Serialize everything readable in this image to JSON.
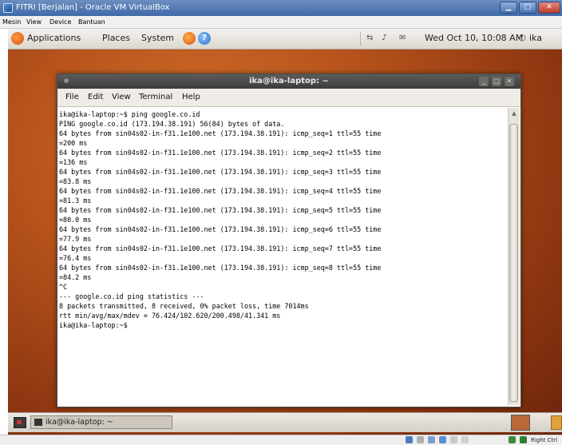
{
  "vbox": {
    "title": "FITRI [Berjalan] - Oracle VM VirtualBox",
    "menu": [
      "Mesin",
      "View",
      "Device",
      "Bantuan"
    ],
    "host_key": "Right Ctrl"
  },
  "top_panel": {
    "applications": "Applications",
    "places": "Places",
    "system": "System",
    "clock": "Wed Oct 10, 10:08 AM",
    "user": "ika"
  },
  "terminal": {
    "title": "ika@ika-laptop: ~",
    "menu": [
      "File",
      "Edit",
      "View",
      "Terminal",
      "Help"
    ],
    "lines": [
      "ika@ika-laptop:~$ ping google.co.id",
      "PING google.co.id (173.194.38.191) 56(84) bytes of data.",
      "64 bytes from sin04s02-in-f31.1e100.net (173.194.38.191): icmp_seq=1 ttl=55 time",
      "=200 ms",
      "64 bytes from sin04s02-in-f31.1e100.net (173.194.38.191): icmp_seq=2 ttl=55 time",
      "=136 ms",
      "64 bytes from sin04s02-in-f31.1e100.net (173.194.38.191): icmp_seq=3 ttl=55 time",
      "=83.8 ms",
      "64 bytes from sin04s02-in-f31.1e100.net (173.194.38.191): icmp_seq=4 ttl=55 time",
      "=81.3 ms",
      "64 bytes from sin04s02-in-f31.1e100.net (173.194.38.191): icmp_seq=5 ttl=55 time",
      "=80.0 ms",
      "64 bytes from sin04s02-in-f31.1e100.net (173.194.38.191): icmp_seq=6 ttl=55 time",
      "=77.9 ms",
      "64 bytes from sin04s02-in-f31.1e100.net (173.194.38.191): icmp_seq=7 ttl=55 time",
      "=76.4 ms",
      "64 bytes from sin04s02-in-f31.1e100.net (173.194.38.191): icmp_seq=8 ttl=55 time",
      "=84.2 ms",
      "^C",
      "--- google.co.id ping statistics ---",
      "8 packets transmitted, 8 received, 0% packet loss, time 7014ms",
      "rtt min/avg/max/mdev = 76.424/102.620/200.498/41.341 ms",
      "ika@ika-laptop:~$"
    ]
  },
  "bottom_panel": {
    "task_label": "ika@ika-laptop: ~"
  },
  "icons": {
    "vbox_app": "virtualbox-icon",
    "ubuntu_foot": "ubuntu-menu-icon",
    "firefox": "firefox-icon",
    "help": "help-icon",
    "network": "network-icon",
    "volume": "volume-icon",
    "mail": "mail-icon",
    "power": "power-icon",
    "terminal": "terminal-icon",
    "show_desktop": "show-desktop-icon",
    "trash": "trash-icon"
  },
  "colors": {
    "desktop_orange": "#b8541c",
    "terminal_title": "#3b3b39",
    "vbox_title": "#3f69a8"
  }
}
